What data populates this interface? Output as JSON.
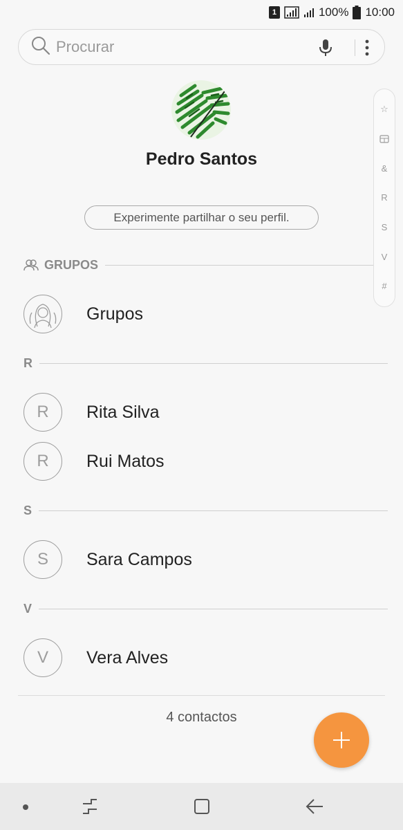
{
  "status_bar": {
    "sim": "1",
    "battery_pct": "100%",
    "time": "10:00"
  },
  "search": {
    "placeholder": "Procurar",
    "icons": [
      "search-icon",
      "mic-icon",
      "more-vert-icon"
    ]
  },
  "profile": {
    "name": "Pedro Santos",
    "share_prompt": "Experimente partilhar o seu perfil."
  },
  "index": [
    "☆",
    "group-icon",
    "&",
    "R",
    "S",
    "V",
    "#"
  ],
  "groups_header": "GRUPOS",
  "groups_item": {
    "label": "Grupos"
  },
  "sections": [
    {
      "letter": "R",
      "contacts": [
        {
          "initial": "R",
          "name": "Rita Silva"
        },
        {
          "initial": "R",
          "name": "Rui Matos"
        }
      ]
    },
    {
      "letter": "S",
      "contacts": [
        {
          "initial": "S",
          "name": "Sara Campos"
        }
      ]
    },
    {
      "letter": "V",
      "contacts": [
        {
          "initial": "V",
          "name": "Vera Alves"
        }
      ]
    }
  ],
  "footer": {
    "count": "4 contactos"
  },
  "colors": {
    "accent": "#f5953f",
    "background": "#f7f7f7",
    "navbar": "#eaeaea"
  }
}
